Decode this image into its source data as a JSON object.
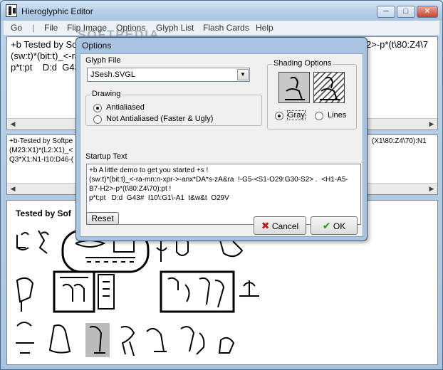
{
  "window": {
    "title": "Hieroglyphic Editor",
    "min_glyph": "─",
    "max_glyph": "□",
    "close_glyph": "✕"
  },
  "menu": {
    "items": [
      "Go",
      "File",
      "Flip Image",
      "Options",
      "Glyph List",
      "Flash Cards",
      "Help"
    ],
    "separator": "|"
  },
  "watermark": "SOFTPEDIA",
  "editor": {
    "line1": "+b Tested by So",
    "line1_right": "2>-p*(t\\80:Z4\\7",
    "line2": "(sw:t)*(bit:t)_<-ra",
    "line3": "p*t:pt    D:d  G43"
  },
  "mid_pane": {
    "line1": "+b-Tested by Softpe",
    "line1_right": "(X1\\80:Z4\\70):N1",
    "line2": "(M23:X1)*(L2:X1)_<",
    "line3": "Q3*X1:N1-I10:D46-("
  },
  "preview": {
    "title": "Tested by Sof"
  },
  "dialog": {
    "title": "Options",
    "glyph_file_label": "Glyph File",
    "glyph_file_value": "JSesh.SVGL",
    "drawing_label": "Drawing",
    "drawing_options": [
      "Antialiased",
      "Not Antialiased (Faster & Ugly)"
    ],
    "drawing_selected": 0,
    "shading_label": "Shading Options",
    "shading_options": [
      "Gray",
      "Lines"
    ],
    "shading_selected": 0,
    "startup_label": "Startup Text",
    "startup_lines": [
      "+b A little demo to get you started +s !",
      "(sw:t)*(bit:t)_<-ra-mn:n-xpr->-anx*DA*s-zA&ra  !-G5-<S1-O29:G30-S2> .  <H1-A5-",
      "B7-H2>-p*(t\\80:Z4\\70):pt !",
      "p*t:pt   D:d  G43#  I10\\:G1\\-A1  t&w&t  O29V"
    ],
    "reset_label": "Reset",
    "cancel_label": "Cancel",
    "ok_label": "OK",
    "cancel_icon": "✖",
    "ok_icon": "✔"
  }
}
